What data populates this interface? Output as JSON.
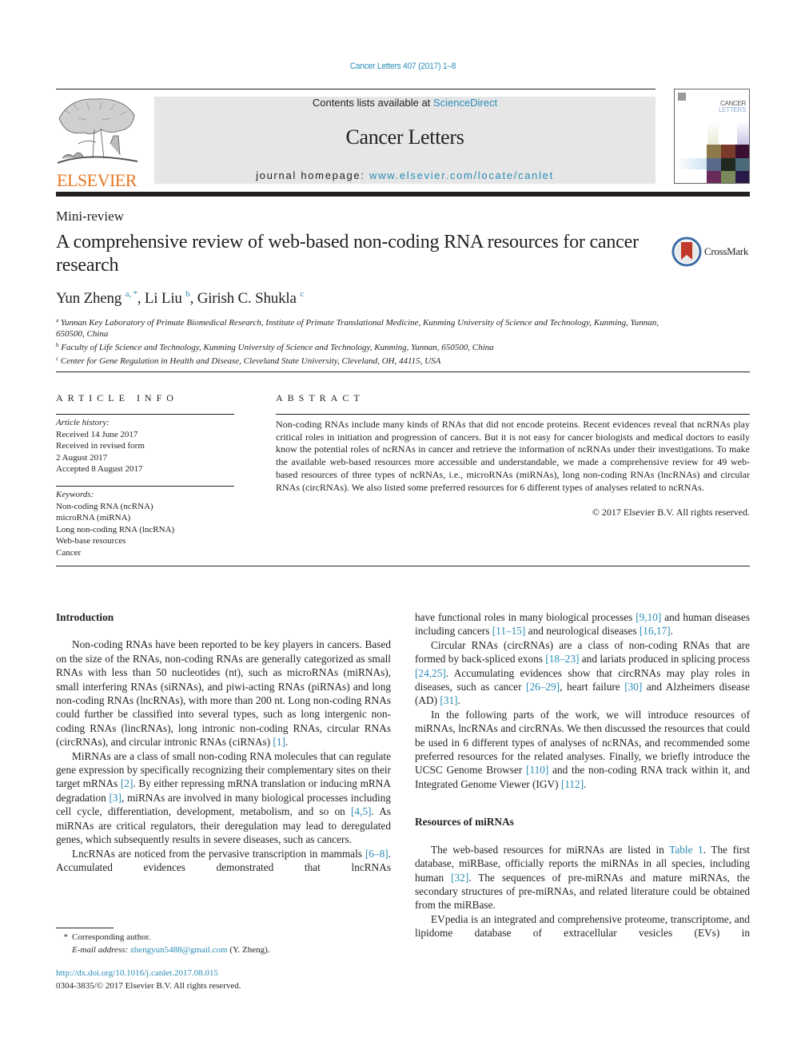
{
  "header": {
    "journal_ref": "Cancer Letters 407 (2017) 1–8",
    "publisher_logo_text": "ELSEVIER",
    "contents_prefix": "Contents lists available at ",
    "contents_link": "ScienceDirect",
    "journal_title": "Cancer Letters",
    "homepage_prefix": "journal homepage: ",
    "homepage_link": "www.elsevier.com/locate/canlet",
    "cover_line1": "CANCER",
    "cover_line2": "LETTERS",
    "colors": {
      "link": "#2a8cb5",
      "elsevier_orange": "#e87722",
      "banner_bg": "#e6e6e6"
    }
  },
  "article": {
    "type": "Mini-review",
    "title": "A comprehensive review of web-based non-coding RNA resources for cancer research",
    "crossmark_label": "CrossMark",
    "authors": [
      {
        "name": "Yun Zheng",
        "sup": "a, *"
      },
      {
        "name": "Li Liu",
        "sup": "b"
      },
      {
        "name": "Girish C. Shukla",
        "sup": "c"
      }
    ],
    "affiliations": [
      {
        "key": "a",
        "text": "Yunnan Key Laboratory of Primate Biomedical Research, Institute of Primate Translational Medicine, Kunming University of Science and Technology, Kunming, Yunnan, 650500, China"
      },
      {
        "key": "b",
        "text": "Faculty of Life Science and Technology, Kunming University of Science and Technology, Kunming, Yunnan, 650500, China"
      },
      {
        "key": "c",
        "text": "Center for Gene Regulation in Health and Disease, Cleveland State University, Cleveland, OH, 44115, USA"
      }
    ]
  },
  "article_info": {
    "heading": "ARTICLE INFO",
    "history_label": "Article history:",
    "history": [
      "Received 14 June 2017",
      "Received in revised form",
      "2 August 2017",
      "Accepted 8 August 2017"
    ],
    "keywords_label": "Keywords:",
    "keywords": [
      "Non-coding RNA (ncRNA)",
      "microRNA (miRNA)",
      "Long non-coding RNA (lncRNA)",
      "Web-base resources",
      "Cancer"
    ]
  },
  "abstract": {
    "heading": "ABSTRACT",
    "text": "Non-coding RNAs include many kinds of RNAs that did not encode proteins. Recent evidences reveal that ncRNAs play critical roles in initiation and progression of cancers. But it is not easy for cancer biologists and medical doctors to easily know the potential roles of ncRNAs in cancer and retrieve the information of ncRNAs under their investigations. To make the available web-based resources more accessible and understandable, we made a comprehensive review for 49 web-based resources of three types of ncRNAs, i.e., microRNAs (miRNAs), long non-coding RNAs (lncRNAs) and circular RNAs (circRNAs). We also listed some preferred resources for 6 different types of analyses related to ncRNAs.",
    "copyright": "© 2017 Elsevier B.V. All rights reserved."
  },
  "body": {
    "intro_heading": "Introduction",
    "p1": [
      {
        "t": "Non-coding RNAs have been reported to be key players in cancers. Based on the size of the RNAs, non-coding RNAs are generally categorized as small RNAs with less than 50 nucleotides (nt), such as microRNAs (miRNAs), small interfering RNAs (siRNAs), and piwi-acting RNAs (piRNAs) and long non-coding RNAs (lncRNAs), with more than 200 nt. Long non-coding RNAs could further be classified into several types, such as long intergenic non-coding RNAs (lincRNAs), long intronic non-coding RNAs, circular RNAs (circRNAs), and circular intronic RNAs (ciRNAs) "
      },
      {
        "ref": "[1]"
      },
      {
        "t": "."
      }
    ],
    "p2": [
      {
        "t": "MiRNAs are a class of small non-coding RNA molecules that can regulate gene expression by specifically recognizing their complementary sites on their target mRNAs "
      },
      {
        "ref": "[2]"
      },
      {
        "t": ". By either repressing mRNA translation or inducing mRNA degradation "
      },
      {
        "ref": "[3]"
      },
      {
        "t": ", miRNAs are involved in many biological processes including cell cycle, differentiation, development, metabolism, and so on "
      },
      {
        "ref": "[4,5]"
      },
      {
        "t": ". As miRNAs are critical regulators, their deregulation may lead to deregulated genes, which subsequently results in severe diseases, such as cancers."
      }
    ],
    "p3": [
      {
        "t": "LncRNAs are noticed from the pervasive transcription in mammals "
      },
      {
        "ref": "[6–8]"
      },
      {
        "t": ". Accumulated evidences demonstrated that lncRNAs have functional roles in many biological processes "
      },
      {
        "ref": "[9,10]"
      },
      {
        "t": " and human diseases including cancers "
      },
      {
        "ref": "[11–15]"
      },
      {
        "t": " and neurological diseases "
      },
      {
        "ref": "[16,17]"
      },
      {
        "t": "."
      }
    ],
    "p4": [
      {
        "t": "Circular RNAs (circRNAs) are a class of non-coding RNAs that are formed by back-spliced exons "
      },
      {
        "ref": "[18–23]"
      },
      {
        "t": " and lariats produced in splicing process "
      },
      {
        "ref": "[24,25]"
      },
      {
        "t": ". Accumulating evidences show that circRNAs may play roles in diseases, such as cancer "
      },
      {
        "ref": "[26–29]"
      },
      {
        "t": ", heart failure "
      },
      {
        "ref": "[30]"
      },
      {
        "t": " and Alzheimers disease (AD) "
      },
      {
        "ref": "[31]"
      },
      {
        "t": "."
      }
    ],
    "p5": [
      {
        "t": "In the following parts of the work, we will introduce resources of miRNAs, lncRNAs and circRNAs. We then discussed the resources that could be used in 6 different types of analyses of ncRNAs, and recommended some preferred resources for the related analyses. Finally, we briefly introduce the UCSC Genome Browser "
      },
      {
        "ref": "[110]"
      },
      {
        "t": " and the non-coding RNA track within it, and Integrated Genome Viewer (IGV) "
      },
      {
        "ref": "[112]"
      },
      {
        "t": "."
      }
    ],
    "mirna_heading": "Resources of miRNAs",
    "p6": [
      {
        "t": "The web-based resources for miRNAs are listed in "
      },
      {
        "ref": "Table 1"
      },
      {
        "t": ". The first database, miRBase, officially reports the miRNAs in all species, including human "
      },
      {
        "ref": "[32]"
      },
      {
        "t": ". The sequences of pre-miRNAs and mature miRNAs, the secondary structures of pre-miRNAs, and related literature could be obtained from the miRBase."
      }
    ],
    "p7": [
      {
        "t": "EVpedia is an integrated and comprehensive proteome, transcriptome, and lipidome database of extracellular vesicles (EVs) in"
      }
    ]
  },
  "footer": {
    "corresponding": "Corresponding author.",
    "corresponding_mark": "*",
    "email_label": "E-mail address: ",
    "email": "zhengyun5488@gmail.com",
    "email_suffix": " (Y. Zheng).",
    "doi": "http://dx.doi.org/10.1016/j.canlet.2017.08.015",
    "issn_copyright": "0304-3835/© 2017 Elsevier B.V. All rights reserved."
  }
}
